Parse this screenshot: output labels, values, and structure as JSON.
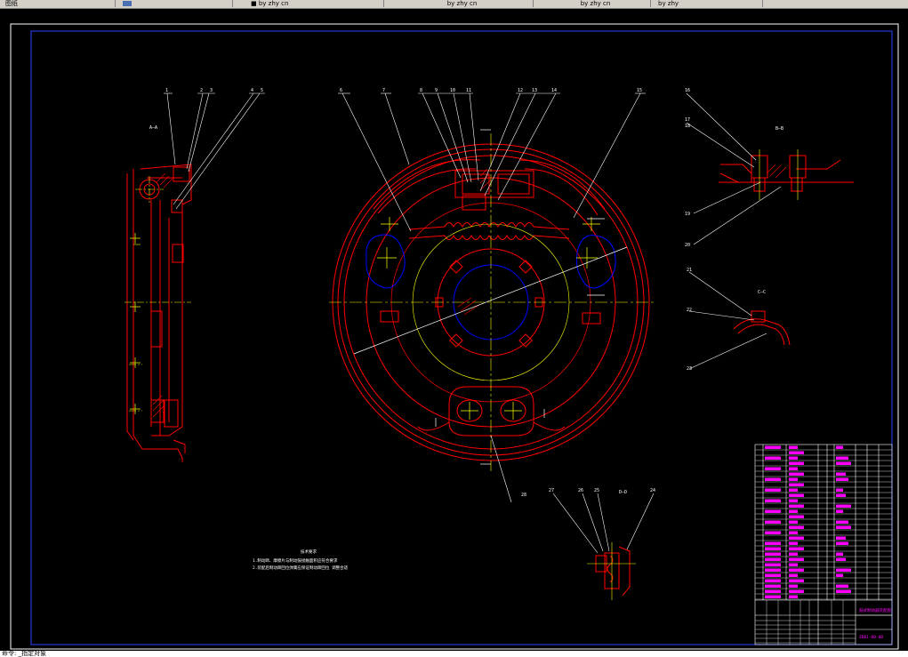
{
  "tabs": [
    {
      "label": "图纸"
    },
    {
      "label": ""
    },
    {
      "label": "■ by zhy cn"
    },
    {
      "label": "by zhy cn"
    },
    {
      "label": "by zhy cn"
    },
    {
      "label": "by zhy"
    }
  ],
  "command_line": "命令: _指定对象",
  "drawing": {
    "section_labels": [
      "A—A",
      "B—B",
      "C—C",
      "D—D"
    ],
    "part_numbers_top": [
      "1",
      "2",
      "3",
      "4",
      "5",
      "6",
      "7",
      "8",
      "9",
      "10",
      "11",
      "12",
      "13",
      "14",
      "15"
    ],
    "part_numbers_right": [
      "16",
      "17",
      "18",
      "19",
      "20",
      "21",
      "22",
      "23"
    ],
    "part_numbers_bottom": [
      "24",
      "25",
      "26",
      "27",
      "28"
    ],
    "technical_requirements_title": "技术要求",
    "technical_requirements": [
      "1.制动蹄、摩擦片与制动鼓接触面积应符合要求",
      "2.装配后制动蹄回位弹簧应保证制动蹄回位 调整合适"
    ],
    "title_block": {
      "drawing_title": "鼓式制动器装配图",
      "drawing_number": "ZD01-00-00"
    }
  },
  "colors": {
    "outline": "#ffffff",
    "part": "#ff0000",
    "centerline": "#ffff00",
    "hidden": "#0000ff",
    "magenta": "#ff00ff",
    "dimension": "#ffffff",
    "background": "#000000"
  }
}
